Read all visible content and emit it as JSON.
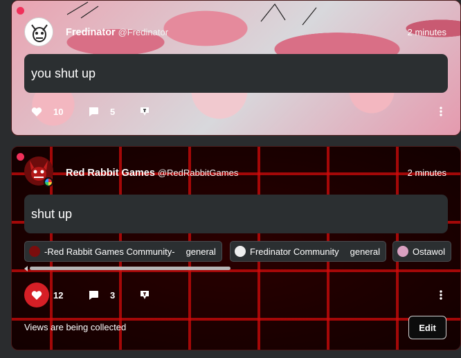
{
  "posts": [
    {
      "author": {
        "name": "Fredinator",
        "handle": "@Fredinator"
      },
      "time": "2 minutes",
      "message": "you shut up",
      "likes": "10",
      "comments": "5"
    },
    {
      "author": {
        "name": "Red Rabbit Games",
        "handle": "@RedRabbitGames"
      },
      "time": "2 minutes",
      "message": "shut up",
      "likes": "12",
      "comments": "3",
      "communities": [
        {
          "name": "-Red Rabbit Games Community-",
          "channel": "general"
        },
        {
          "name": "Fredinator Community",
          "channel": "general"
        },
        {
          "name": "Ostawol",
          "channel": ""
        }
      ],
      "views_text": "Views are being collected",
      "edit_label": "Edit"
    }
  ],
  "colors": {
    "like_active": "#d61f26",
    "online_dot": "#f0305a",
    "bubble_bg": "#2b2f31"
  }
}
